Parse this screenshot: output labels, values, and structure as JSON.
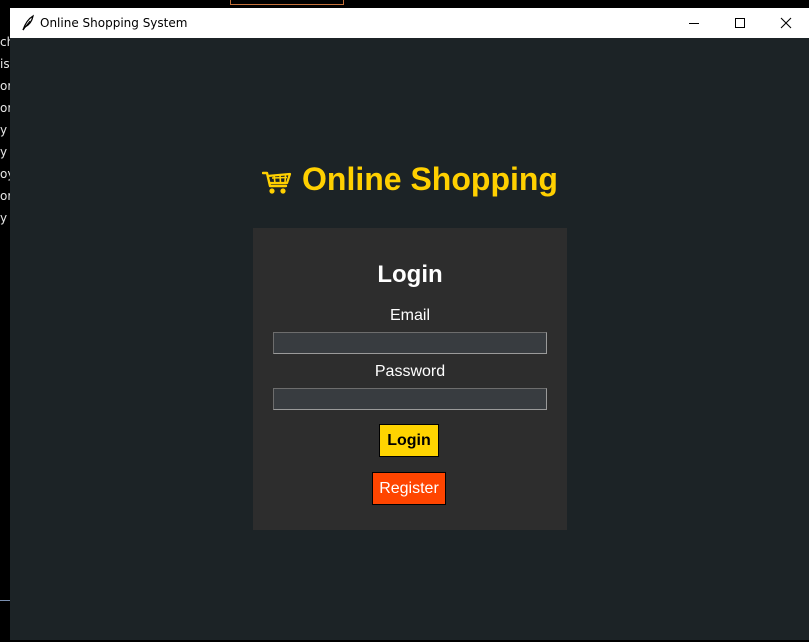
{
  "background": {
    "side_text": [
      "ch",
      "ist",
      "ori",
      "ory",
      "y",
      "y",
      "oy",
      "or",
      "y"
    ]
  },
  "window": {
    "title": "Online Shopping System",
    "app_icon": "feather-icon",
    "controls": [
      "minimize-icon",
      "maximize-icon",
      "close-icon"
    ]
  },
  "brand": {
    "icon": "shopping-cart-icon",
    "title": "Online Shopping"
  },
  "login": {
    "heading": "Login",
    "email_label": "Email",
    "email_value": "",
    "password_label": "Password",
    "password_value": "",
    "login_button": "Login",
    "register_button": "Register"
  },
  "colors": {
    "window_bg": "#1c2326",
    "panel_bg": "#2d2d2d",
    "accent_yellow": "#ffd000",
    "register_orange": "#ff4500",
    "input_bg": "#383c40"
  }
}
